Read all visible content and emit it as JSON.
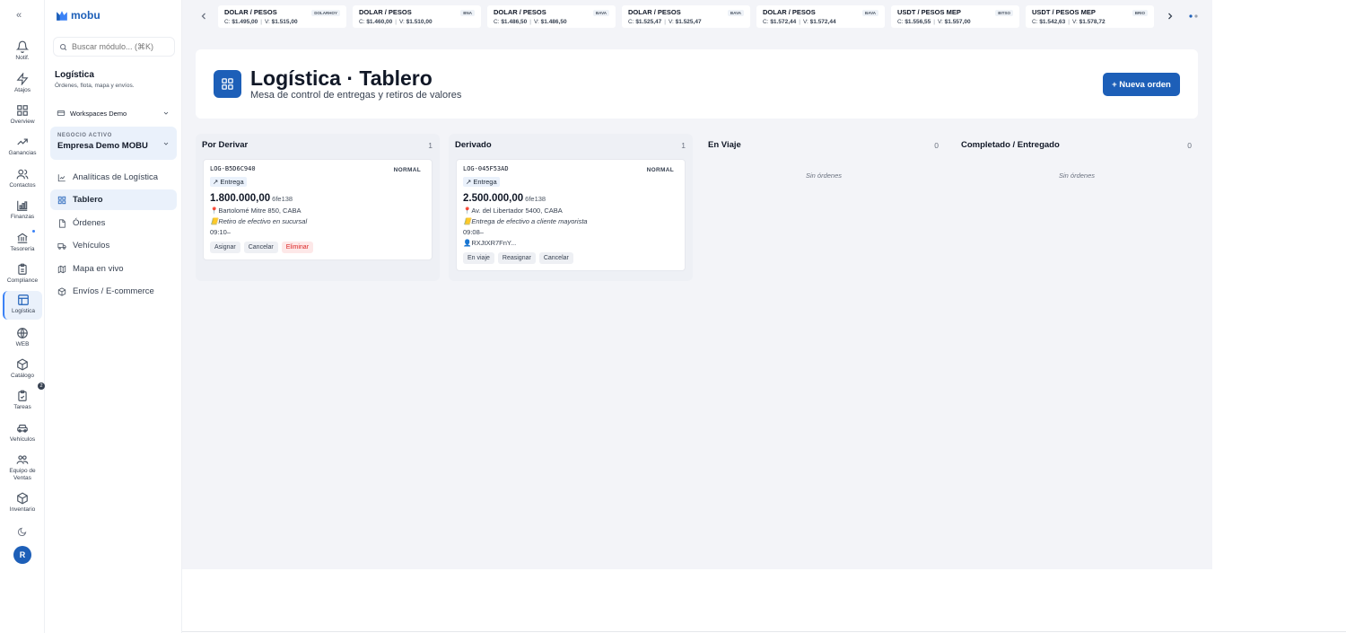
{
  "colors": {
    "brand": "#1d5fb8",
    "accent_bg": "#eaf1fb",
    "danger": "#dc2626",
    "main_bg": "#f3f4f8"
  },
  "rail": {
    "items": [
      {
        "label": "Notif.",
        "icon": "bell-icon"
      },
      {
        "label": "Atajos",
        "icon": "lightning-icon"
      },
      {
        "label": "Overview",
        "icon": "grid-icon"
      },
      {
        "label": "Ganancias",
        "icon": "trending-up-icon"
      },
      {
        "label": "Contactos",
        "icon": "users-icon"
      },
      {
        "label": "Finanzas",
        "icon": "bar-chart-icon"
      },
      {
        "label": "Tesorería",
        "icon": "bank-icon"
      },
      {
        "label": "Compliance",
        "icon": "clipboard-icon"
      },
      {
        "label": "Logística",
        "icon": "boxes-icon"
      },
      {
        "label": "WEB",
        "icon": "globe-icon"
      },
      {
        "label": "Catálogo",
        "icon": "package-icon"
      },
      {
        "label": "Tareas",
        "icon": "clipboard-check-icon"
      },
      {
        "label": "Vehículos",
        "icon": "car-icon"
      },
      {
        "label": "Equipo de Ventas",
        "icon": "team-icon"
      },
      {
        "label": "Inventario",
        "icon": "cube-icon"
      }
    ],
    "tasks_badge": "2",
    "avatar_initial": "R"
  },
  "sidebar": {
    "logo_text": "mobu",
    "search_placeholder": "Buscar módulo... (⌘K)",
    "section_title": "Logística",
    "section_subtitle": "Órdenes, flota, mapa y envíos.",
    "workspace": "Workspaces Demo",
    "business_caption": "NEGOCIO ACTIVO",
    "business_name": "Empresa Demo MOBU",
    "nav": [
      {
        "label": "Analíticas de Logística",
        "icon": "chart-icon"
      },
      {
        "label": "Tablero",
        "icon": "board-icon"
      },
      {
        "label": "Órdenes",
        "icon": "file-icon"
      },
      {
        "label": "Vehículos",
        "icon": "truck-icon"
      },
      {
        "label": "Mapa en vivo",
        "icon": "map-icon"
      },
      {
        "label": "Envíos / E-commerce",
        "icon": "package-icon"
      }
    ]
  },
  "ticker": [
    {
      "title": "DOLAR / PESOS",
      "badge": "DOLARHOY",
      "c": "$1.495,00",
      "v": "$1.515,00"
    },
    {
      "title": "DOLAR / PESOS",
      "badge": "BNA",
      "c": "$1.460,00",
      "v": "$1.510,00"
    },
    {
      "title": "DOLAR / PESOS",
      "badge": "BAVA",
      "c": "$1.486,50",
      "v": "$1.486,50"
    },
    {
      "title": "DOLAR / PESOS",
      "badge": "BAVA",
      "c": "$1.525,47",
      "v": "$1.525,47"
    },
    {
      "title": "DOLAR / PESOS",
      "badge": "BAVA",
      "c": "$1.572,44",
      "v": "$1.572,44"
    },
    {
      "title": "USDT / PESOS MEP",
      "badge": "BITSO",
      "c": "$1.556,55",
      "v": "$1.557,00"
    },
    {
      "title": "USDT / PESOS MEP",
      "badge": "BRIO",
      "c": "$1.542,63",
      "v": "$1.578,72"
    }
  ],
  "ticker_labels": {
    "c": "C:",
    "v": "V:",
    "sep": "|"
  },
  "header": {
    "title": "Logística · Tablero",
    "subtitle": "Mesa de control de entregas y retiros de valores",
    "new_button": "+ Nueva orden"
  },
  "columns": [
    {
      "title": "Por Derivar",
      "count": "1"
    },
    {
      "title": "Derivado",
      "count": "1"
    },
    {
      "title": "En Viaje",
      "count": "0",
      "empty": "Sin órdenes"
    },
    {
      "title": "Completado / Entregado",
      "count": "0",
      "empty": "Sin órdenes"
    }
  ],
  "orders": [
    {
      "id": "LOG-B5D6C940",
      "priority": "NORMAL",
      "type": "↗ Entrega",
      "amount": "1.800.000,00",
      "currency": "6fe138",
      "address": "📍Bartolomé Mitre 850, CABA",
      "note": "📒Retiro de efectivo en sucursal",
      "time": "09:10–",
      "actions": [
        "Asignar",
        "Cancelar",
        "Eliminar"
      ]
    },
    {
      "id": "LOG-045F53AD",
      "priority": "NORMAL",
      "type": "↗ Entrega",
      "amount": "2.500.000,00",
      "currency": "6fe138",
      "address": "📍Av. del Libertador 5400, CABA",
      "note": "📒Entrega de efectivo a cliente mayorista",
      "time": "09:08–",
      "assignee": "👤RXJtXR7FnY...",
      "actions": [
        "En viaje",
        "Reasignar",
        "Cancelar"
      ]
    }
  ]
}
